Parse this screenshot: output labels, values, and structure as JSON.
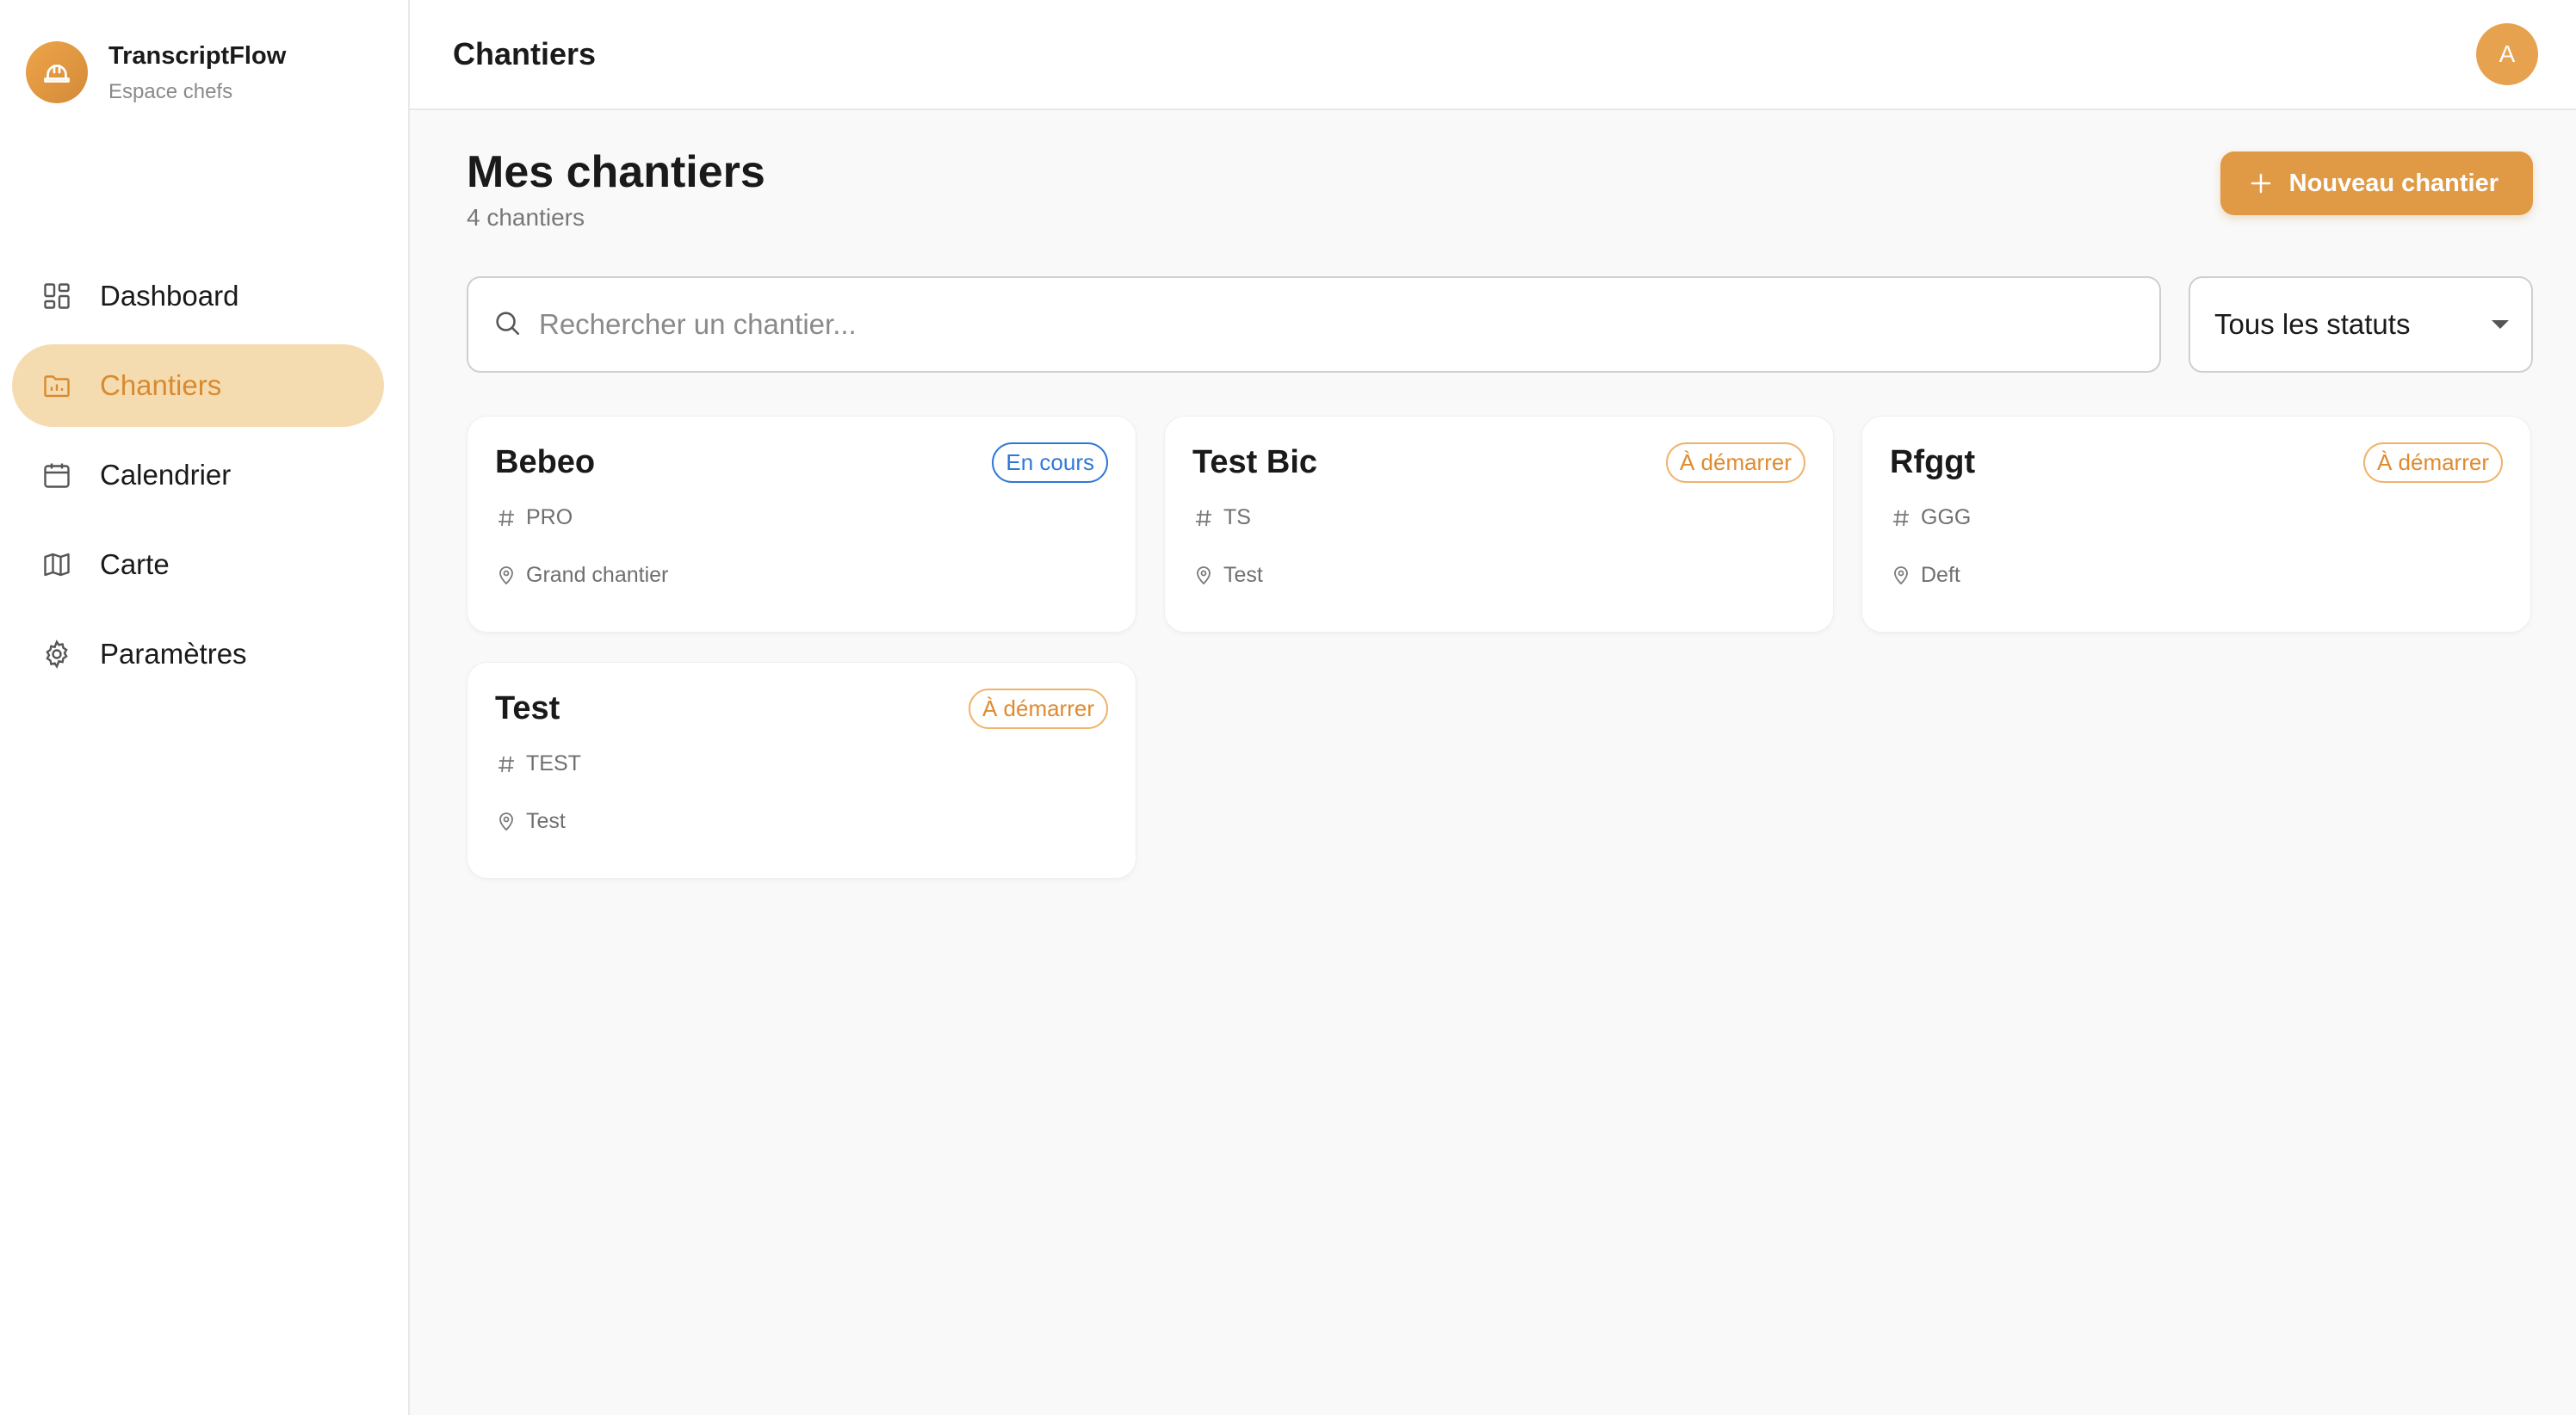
{
  "brand": {
    "name": "TranscriptFlow",
    "subtitle": "Espace chefs",
    "icon": "hardhat-icon"
  },
  "sidebar": {
    "items": [
      {
        "label": "Dashboard",
        "icon": "dashboard-icon",
        "active": false
      },
      {
        "label": "Chantiers",
        "icon": "folder-icon",
        "active": true
      },
      {
        "label": "Calendrier",
        "icon": "calendar-icon",
        "active": false
      },
      {
        "label": "Carte",
        "icon": "map-icon",
        "active": false
      },
      {
        "label": "Paramètres",
        "icon": "gear-icon",
        "active": false
      }
    ]
  },
  "topbar": {
    "title": "Chantiers",
    "avatar_initial": "A"
  },
  "page": {
    "title": "Mes chantiers",
    "count": "4 chantiers",
    "new_button": "Nouveau chantier"
  },
  "search": {
    "placeholder": "Rechercher un chantier..."
  },
  "status_filter": {
    "selected": "Tous les statuts"
  },
  "cards": [
    {
      "title": "Bebeo",
      "status": "En cours",
      "code": "PRO",
      "location": "Grand chantier"
    },
    {
      "title": "Test Bic",
      "status": "À démarrer",
      "code": "TS",
      "location": "Test"
    },
    {
      "title": "Rfggt",
      "status": "À démarrer",
      "code": "GGG",
      "location": "Deft"
    },
    {
      "title": "Test",
      "status": "À démarrer",
      "code": "TEST",
      "location": "Test"
    }
  ],
  "colors": {
    "accent": "#e09a45",
    "active_bg": "#f5dcb0",
    "blue_status": "#2f78d6",
    "orange_status": "#e08a30"
  }
}
